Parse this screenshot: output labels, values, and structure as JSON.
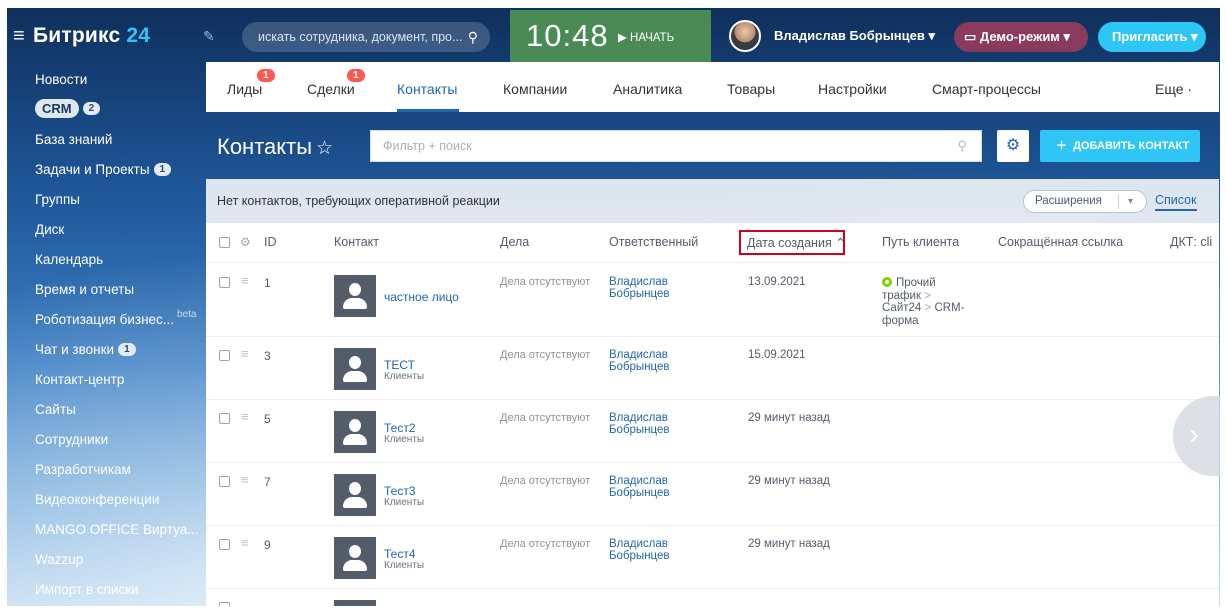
{
  "topbar": {
    "logo_text": "Битрикс",
    "logo_num": "24",
    "search_placeholder": "искать сотрудника, документ, про...",
    "clock_time": "10:48",
    "clock_start": "НАЧАТЬ",
    "user_name": "Владислав Бобрынцев",
    "demo_label": "Демо-режим",
    "invite_label": "Пригласить"
  },
  "sidebar": {
    "items": [
      {
        "label": "Новости"
      },
      {
        "label": "CRM",
        "badge": "2"
      },
      {
        "label": "База знаний"
      },
      {
        "label": "Задачи и Проекты",
        "badge": "1"
      },
      {
        "label": "Группы"
      },
      {
        "label": "Диск"
      },
      {
        "label": "Календарь"
      },
      {
        "label": "Время и отчеты"
      },
      {
        "label": "Роботизация бизнес...",
        "tag": "beta"
      },
      {
        "label": "Чат и звонки",
        "badge": "1"
      },
      {
        "label": "Контакт-центр"
      },
      {
        "label": "Сайты"
      },
      {
        "label": "Сотрудники"
      },
      {
        "label": "Разработчикам"
      },
      {
        "label": "Видеоконференции"
      },
      {
        "label": "MANGO OFFICE Виртуа..."
      },
      {
        "label": "Wazzup"
      },
      {
        "label": "Импорт в списки"
      }
    ]
  },
  "tabs": [
    {
      "label": "Лиды",
      "count": "1"
    },
    {
      "label": "Сделки",
      "count": "1"
    },
    {
      "label": "Контакты"
    },
    {
      "label": "Компании"
    },
    {
      "label": "Аналитика"
    },
    {
      "label": "Товары"
    },
    {
      "label": "Настройки"
    },
    {
      "label": "Смарт-процессы"
    },
    {
      "label": "Еще ·"
    }
  ],
  "page": {
    "title": "Контакты",
    "filter_placeholder": "Фильтр + поиск",
    "add_button": "ДОБАВИТЬ КОНТАКТ",
    "notice": "Нет контактов, требующих оперативной реакции",
    "extensions": "Расширения",
    "list_view": "Список"
  },
  "grid": {
    "columns": [
      "ID",
      "Контакт",
      "Дела",
      "Ответственный",
      "Дата создания",
      "Путь клиента",
      "Сокращённая ссылка",
      "ДКТ: cli"
    ],
    "rows": [
      {
        "id": "1",
        "name": "частное лицо",
        "type": "",
        "deals": "Дела отсутствуют",
        "resp1": "Владислав",
        "resp2": "Бобрынцев",
        "date": "13.09.2021",
        "path": [
          "Прочий",
          "трафик",
          "Сайт24",
          "CRM-",
          "форма"
        ]
      },
      {
        "id": "3",
        "name": "ТЕСТ",
        "type": "Клиенты",
        "deals": "Дела отсутствуют",
        "resp1": "Владислав",
        "resp2": "Бобрынцев",
        "date": "15.09.2021"
      },
      {
        "id": "5",
        "name": "Тест2",
        "type": "Клиенты",
        "deals": "Дела отсутствуют",
        "resp1": "Владислав",
        "resp2": "Бобрынцев",
        "date": "29 минут назад"
      },
      {
        "id": "7",
        "name": "Тест3",
        "type": "Клиенты",
        "deals": "Дела отсутствуют",
        "resp1": "Владислав",
        "resp2": "Бобрынцев",
        "date": "29 минут назад"
      },
      {
        "id": "9",
        "name": "Тест4",
        "type": "Клиенты",
        "deals": "Дела отсутствуют",
        "resp1": "Владислав",
        "resp2": "Бобрынцев",
        "date": "29 минут назад"
      }
    ]
  },
  "colors": {
    "accent": "#2067b0",
    "primary_button": "#2fc6f6",
    "badge_red": "#ff5752",
    "clock_green": "#4a8a55",
    "demo": "#8a3a5c"
  }
}
